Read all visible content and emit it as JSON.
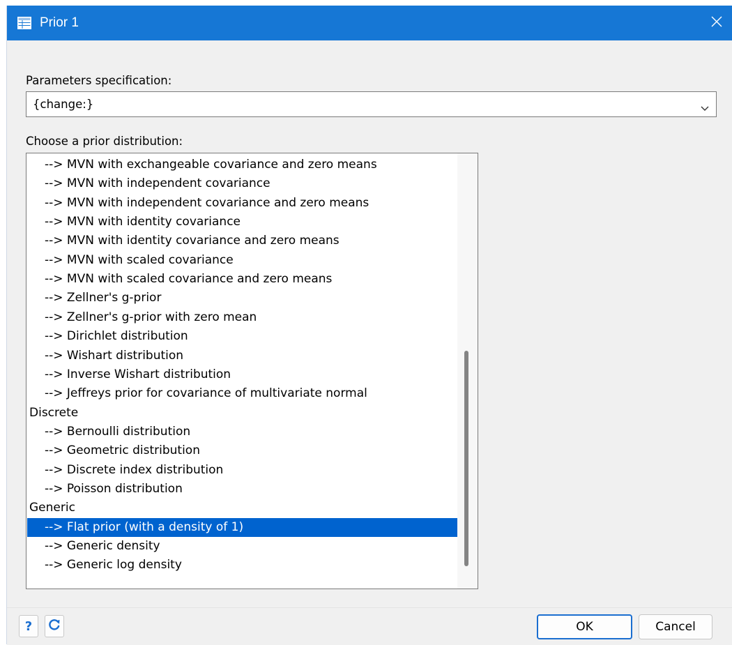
{
  "window": {
    "title": "Prior 1",
    "close_glyph": "✕"
  },
  "params": {
    "label": "Parameters specification:",
    "value": "{change:}"
  },
  "prior": {
    "label": "Choose a prior distribution:",
    "items": [
      {
        "text": "--> MVN with exchangeable covariance and zero means",
        "kind": "sub"
      },
      {
        "text": "--> MVN with independent covariance",
        "kind": "sub"
      },
      {
        "text": "--> MVN with independent covariance and zero means",
        "kind": "sub"
      },
      {
        "text": "--> MVN with identity covariance",
        "kind": "sub"
      },
      {
        "text": "--> MVN with identity covariance and zero means",
        "kind": "sub"
      },
      {
        "text": "--> MVN with scaled covariance",
        "kind": "sub"
      },
      {
        "text": "--> MVN with scaled covariance and zero means",
        "kind": "sub"
      },
      {
        "text": "--> Zellner's g-prior",
        "kind": "sub"
      },
      {
        "text": "--> Zellner's g-prior with zero mean",
        "kind": "sub"
      },
      {
        "text": "--> Dirichlet distribution",
        "kind": "sub"
      },
      {
        "text": "--> Wishart distribution",
        "kind": "sub"
      },
      {
        "text": "--> Inverse Wishart distribution",
        "kind": "sub"
      },
      {
        "text": "--> Jeffreys prior for covariance of multivariate normal",
        "kind": "sub"
      },
      {
        "text": "Discrete",
        "kind": "cat"
      },
      {
        "text": "--> Bernoulli distribution",
        "kind": "sub"
      },
      {
        "text": "--> Geometric distribution",
        "kind": "sub"
      },
      {
        "text": "--> Discrete index distribution",
        "kind": "sub"
      },
      {
        "text": "--> Poisson distribution",
        "kind": "sub"
      },
      {
        "text": "Generic",
        "kind": "cat"
      },
      {
        "text": "--> Flat prior (with a density of 1)",
        "kind": "sub",
        "selected": true
      },
      {
        "text": "--> Generic density",
        "kind": "sub"
      },
      {
        "text": "--> Generic log density",
        "kind": "sub"
      }
    ]
  },
  "footer": {
    "help_glyph": "?",
    "ok_label": "OK",
    "cancel_label": "Cancel"
  },
  "colors": {
    "titlebar": "#1677d5",
    "selection": "#0063cf",
    "accent": "#1a6ed0"
  }
}
